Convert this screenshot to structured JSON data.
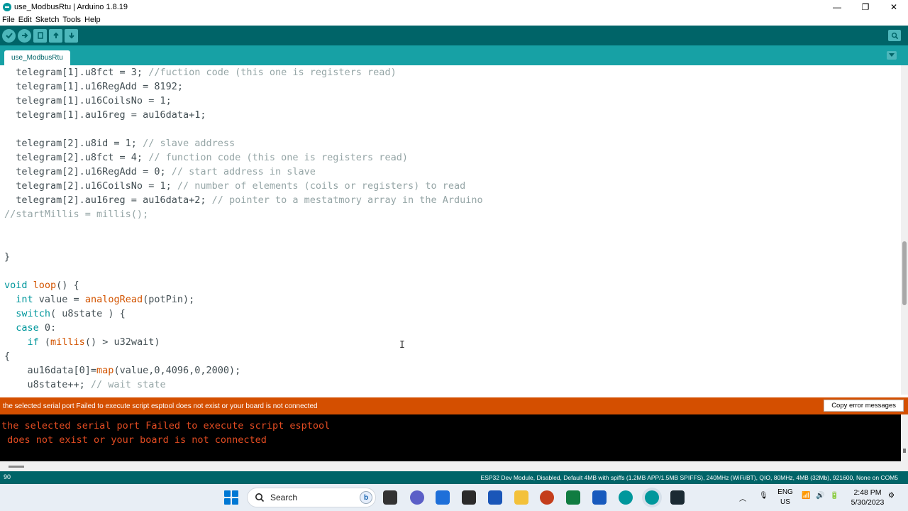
{
  "window": {
    "title": "use_ModbusRtu | Arduino 1.8.19",
    "minimize": "—",
    "maximize": "❐",
    "close": "✕"
  },
  "menu": [
    "File",
    "Edit",
    "Sketch",
    "Tools",
    "Help"
  ],
  "toolbar": {
    "buttons": [
      "verify-icon",
      "upload-icon",
      "new-icon",
      "open-icon",
      "save-icon"
    ],
    "serial_monitor": "magnifier-icon"
  },
  "tabs": {
    "active": "use_ModbusRtu",
    "menu_icon": "▼"
  },
  "editor": {
    "lines": [
      "  telegram[1].u8fct = 3; //fuction code (this one is registers read)",
      "  telegram[1].u16RegAdd = 8192;",
      "  telegram[1].u16CoilsNo = 1;",
      "  telegram[1].au16reg = au16data+1;",
      "",
      "  telegram[2].u8id = 1; // slave address",
      "  telegram[2].u8fct = 4; // function code (this one is registers read)",
      "  telegram[2].u16RegAdd = 0; // start address in slave",
      "  telegram[2].u16CoilsNo = 1; // number of elements (coils or registers) to read",
      "  telegram[2].au16reg = au16data+2; // pointer to a mestatmory array in the Arduino",
      "//startMillis = millis();",
      "",
      "",
      "}",
      "",
      "void loop() {",
      "  int value = analogRead(potPin);",
      "  switch( u8state ) {",
      "  case 0:",
      "    if (millis() > u32wait)",
      "{",
      "    au16data[0]=map(value,0,4096,0,2000);",
      "    u8state++; // wait state"
    ]
  },
  "error": {
    "message": "the selected serial port Failed to execute script esptool does not exist or your board is not connected",
    "copy_button": "Copy error messages"
  },
  "console": {
    "lines": [
      "the selected serial port Failed to execute script esptool",
      " does not exist or your board is not connected"
    ]
  },
  "status": {
    "line_number": "90",
    "board": "ESP32 Dev Module, Disabled, Default 4MB with spiffs (1.2MB APP/1.5MB SPIFFS), 240MHz (WiFi/BT), QIO, 80MHz, 4MB (32Mb), 921600, None on COM5"
  },
  "taskbar": {
    "search": "Search",
    "bing": "b",
    "language": [
      "ENG",
      "US"
    ],
    "time": "2:48 PM",
    "date": "5/30/2023"
  }
}
